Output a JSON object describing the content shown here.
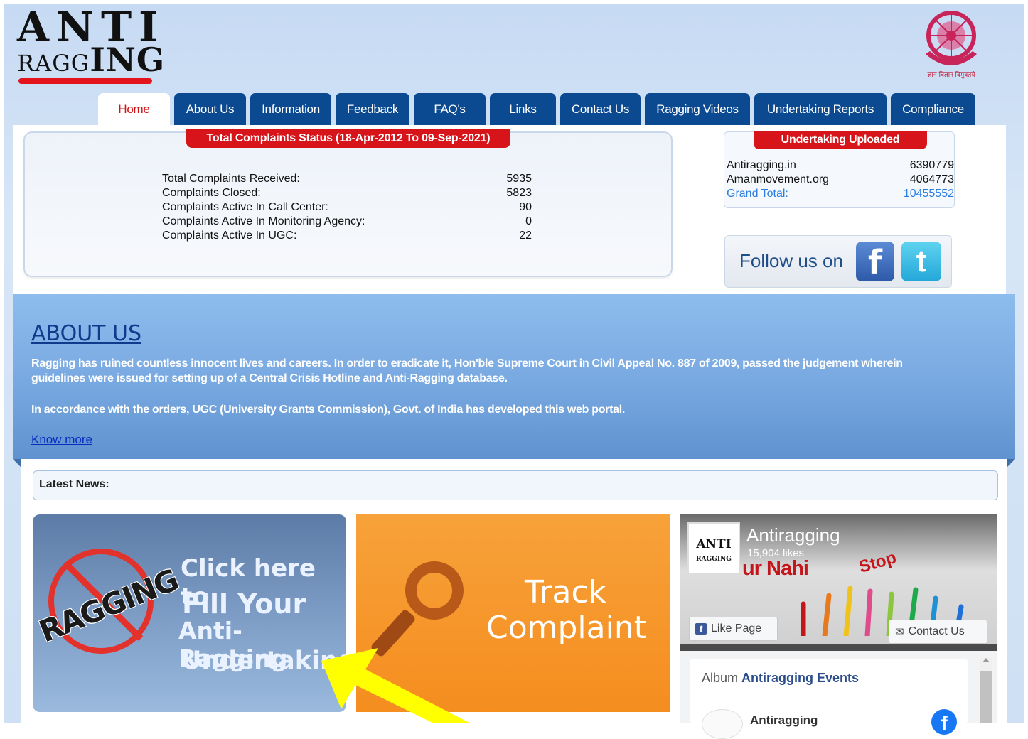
{
  "logo": {
    "line1": "ANTI",
    "line2a": "RAGG",
    "line2b": "ING"
  },
  "ugc_caption": "ज्ञान-विज्ञान विमुक्तये",
  "nav": [
    {
      "label": "Home",
      "active": true
    },
    {
      "label": "About Us"
    },
    {
      "label": "Information"
    },
    {
      "label": "Feedback"
    },
    {
      "label": "FAQ's"
    },
    {
      "label": "Links"
    },
    {
      "label": "Contact Us"
    },
    {
      "label": "Ragging Videos"
    },
    {
      "label": "Undertaking Reports"
    },
    {
      "label": "Compliance"
    }
  ],
  "complaints": {
    "title": "Total Complaints Status (18-Apr-2012 To 09-Sep-2021)",
    "rows": [
      {
        "label": "Total Complaints Received:",
        "value": "5935"
      },
      {
        "label": "Complaints Closed:",
        "value": "5823"
      },
      {
        "label": "Complaints Active In Call Center:",
        "value": "90"
      },
      {
        "label": "Complaints Active In Monitoring Agency:",
        "value": "0"
      },
      {
        "label": "Complaints Active In UGC:",
        "value": "22"
      }
    ]
  },
  "undertaking": {
    "title": "Undertaking Uploaded",
    "rows": [
      {
        "label": "Antiragging.in",
        "value": "6390779"
      },
      {
        "label": "Amanmovement.org",
        "value": "4064773"
      },
      {
        "label": "Grand Total:",
        "value": "10455552"
      }
    ]
  },
  "follow": {
    "text": "Follow us on",
    "fb_glyph": "f",
    "tw_glyph": "t"
  },
  "about": {
    "title": "ABOUT US",
    "p1a": "Ragging has ruined countless innocent lives and careers. In order to eradicate it, Hon'ble Supreme Court in Civil Appeal No. 887 of 2009, passed the judgement wherein",
    "p1b": "guidelines were issued for setting up of a Central Crisis Hotline and Anti-Ragging database.",
    "p2": "In accordance with the orders, UGC (University Grants Commission), Govt. of India has developed this web portal.",
    "link": "Know more"
  },
  "news": {
    "label": "Latest News:"
  },
  "tile_undertaking": {
    "badge": "RAGGING",
    "line1": "Click here to",
    "line2": "Fill Your",
    "line3": "Anti-Ragging",
    "line4": "Undertaking"
  },
  "tile_track": {
    "line1": "Track",
    "line2": "Complaint"
  },
  "fb_widget": {
    "avatar_l1": "ANTI",
    "avatar_l2": "RAGGING",
    "page_name": "Antiragging",
    "likes": "15,904 likes",
    "slogan": "ur Nahi",
    "stop_text": "Stop",
    "like_button": "Like Page",
    "contact_button": "Contact Us",
    "album_prefix": "Album",
    "album_name": "Antiragging Events",
    "post_author": "Antiragging",
    "fb_glyph": "f"
  },
  "colors": {
    "nav_blue": "#0b4a90",
    "accent_red": "#d7141a",
    "about_blue": "#78a8e0",
    "orange": "#f58d1f",
    "arrow_yellow": "#ffff00"
  }
}
